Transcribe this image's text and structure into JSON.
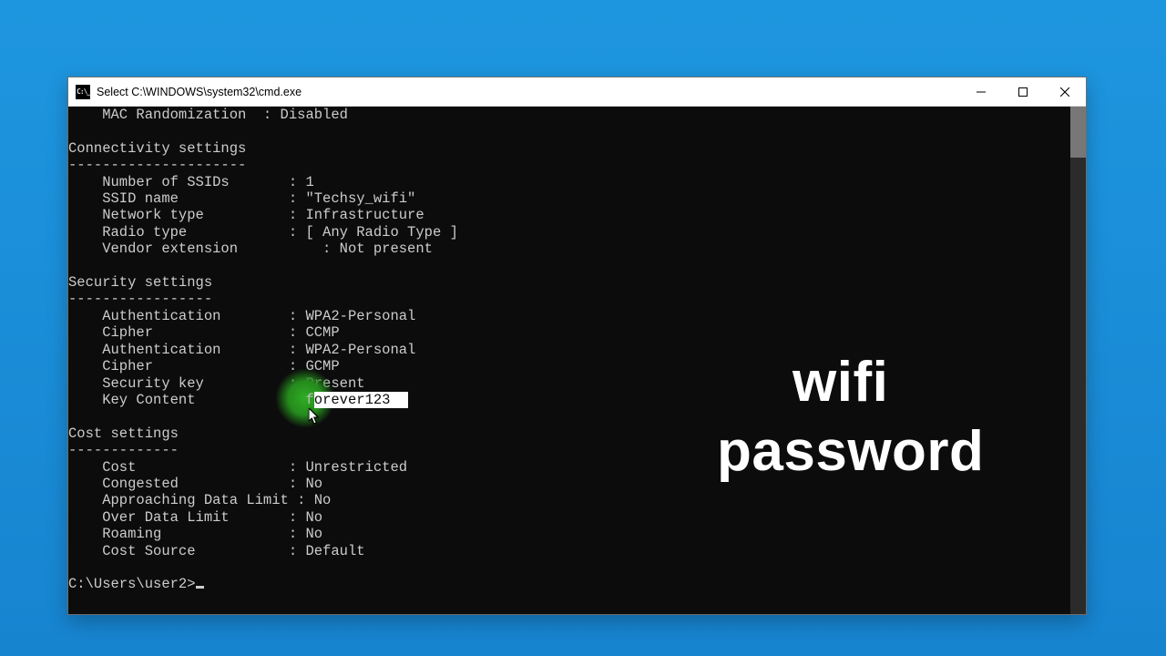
{
  "window": {
    "title": "Select C:\\WINDOWS\\system32\\cmd.exe"
  },
  "terminal": {
    "top_line": "    MAC Randomization  : Disabled",
    "conn_header": "Connectivity settings",
    "conn_divider": "---------------------",
    "num_ssids": "    Number of SSIDs       : 1",
    "ssid_name": "    SSID name             : \"Techsy_wifi\"",
    "network_type": "    Network type          : Infrastructure",
    "radio_type": "    Radio type            : [ Any Radio Type ]",
    "vendor_ext": "    Vendor extension          : Not present",
    "sec_header": "Security settings",
    "sec_divider": "-----------------",
    "auth1": "    Authentication        : WPA2-Personal",
    "cipher1": "    Cipher                : CCMP",
    "auth2": "    Authentication        : WPA2-Personal",
    "cipher2": "    Cipher                : GCMP",
    "sec_key": "    Security key          : Present",
    "key_label": "    Key Content           : ",
    "key_first_char": "f",
    "key_rest": "orever123",
    "cost_header": "Cost settings",
    "cost_divider": "-------------",
    "cost": "    Cost                  : Unrestricted",
    "congested": "    Congested             : No",
    "approach": "    Approaching Data Limit : No",
    "over": "    Over Data Limit       : No",
    "roaming": "    Roaming               : No",
    "cost_source": "    Cost Source           : Default",
    "prompt": "C:\\Users\\user2>"
  },
  "overlay": {
    "line1": "wifi",
    "line2": "password"
  }
}
